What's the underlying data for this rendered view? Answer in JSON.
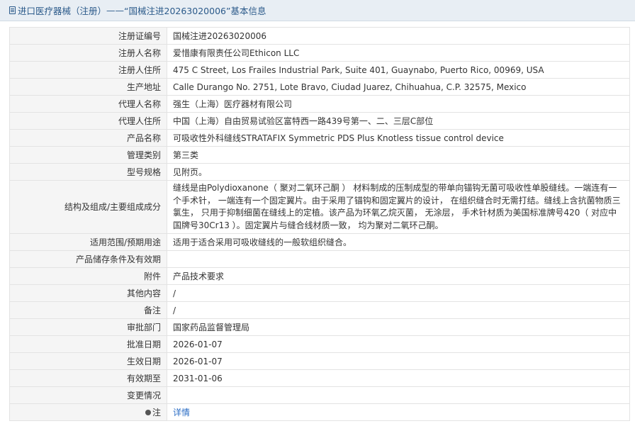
{
  "header": {
    "breadcrumb_root": "进口医疗器械（注册）",
    "separator": " —— ",
    "record_title": "“国械注进20263020006”",
    "section": " 基本信息"
  },
  "rows": [
    {
      "label": "注册证编号",
      "value": "国械注进20263020006"
    },
    {
      "label": "注册人名称",
      "value": "爱惜康有限责任公司Ethicon LLC"
    },
    {
      "label": "注册人住所",
      "value": "475 C Street, Los Frailes Industrial Park, Suite 401, Guaynabo, Puerto Rico, 00969, USA"
    },
    {
      "label": "生产地址",
      "value": "Calle Durango No. 2751, Lote Bravo, Ciudad Juarez, Chihuahua, C.P. 32575, Mexico"
    },
    {
      "label": "代理人名称",
      "value": "强生（上海）医疗器材有限公司"
    },
    {
      "label": "代理人住所",
      "value": "中国（上海）自由贸易试验区富特西一路439号第一、二、三层C部位"
    },
    {
      "label": "产品名称",
      "value": "可吸收性外科缝线STRATAFIX Symmetric PDS Plus Knotless tissue control device"
    },
    {
      "label": "管理类别",
      "value": "第三类"
    },
    {
      "label": "型号规格",
      "value": "见附页。"
    },
    {
      "label": "结构及组成/主要组成成分",
      "value": "缝线是由Polydioxanone（ 聚对二氧环己酮 ） 材料制成的压制成型的带单向锚钩无菌可吸收性单股缝线。一端连有一个手术针， 一端连有一个固定翼片。由于采用了锚钩和固定翼片的设计， 在组织缝合时无需打结。缝线上含抗菌物质三氯生， 只用于抑制细菌在缝线上的定植。该产品为环氧乙烷灭菌， 无涂层， 手术针材质为美国标准牌号420（ 对应中国牌号30Cr13 ）。固定翼片与缝合线材质一致， 均为聚对二氧环己酮。"
    },
    {
      "label": "适用范围/预期用途",
      "value": "适用于适合采用可吸收缝线的一般软组织缝合。"
    },
    {
      "label": "产品储存条件及有效期",
      "value": ""
    },
    {
      "label": "附件",
      "value": "产品技术要求"
    },
    {
      "label": "其他内容",
      "value": "/"
    },
    {
      "label": "备注",
      "value": "/"
    },
    {
      "label": "审批部门",
      "value": "国家药品监督管理局"
    },
    {
      "label": "批准日期",
      "value": "2026-01-07"
    },
    {
      "label": "生效日期",
      "value": "2026-01-07"
    },
    {
      "label": "有效期至",
      "value": "2031-01-06"
    },
    {
      "label": "变更情况",
      "value": ""
    },
    {
      "label": "注",
      "value": "详情"
    }
  ],
  "icons": {
    "header_icon": "document-icon",
    "note_icon": "bullet-icon"
  },
  "colors": {
    "header_bg": "#e8eef4",
    "header_text": "#2b5a8a",
    "label_bg": "#f5f5f5",
    "border": "#e3e3e3",
    "link": "#2a6cc4"
  }
}
